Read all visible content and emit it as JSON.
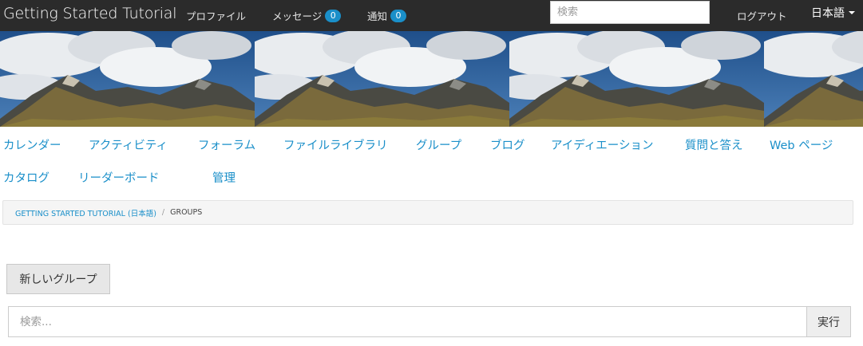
{
  "header": {
    "brand": "Getting Started Tutorial",
    "profile": "プロファイル",
    "messages": "メッセージ",
    "messages_count": "0",
    "notifications": "通知",
    "notifications_count": "0",
    "search_placeholder": "検索",
    "logout": "ログアウト",
    "language": "日本語"
  },
  "tool_nav": [
    "カレンダー",
    "アクティビティ",
    "フォーラム",
    "ファイルライブラリ",
    "グループ",
    "ブログ",
    "アイディエーション",
    "質問と答え",
    "Web ページ",
    "カタログ",
    "リーダーボード",
    "管理"
  ],
  "breadcrumb": {
    "root": "GETTING STARTED TUTORIAL (日本語)",
    "separator": "/",
    "current": "GROUPS"
  },
  "main": {
    "new_group_button": "新しいグループ",
    "search_placeholder": "検索...",
    "search_button": "実行"
  },
  "colors": {
    "topbar": "#2b2b2b",
    "accent": "#1a8fc9",
    "badge": "#1a8fc9"
  }
}
